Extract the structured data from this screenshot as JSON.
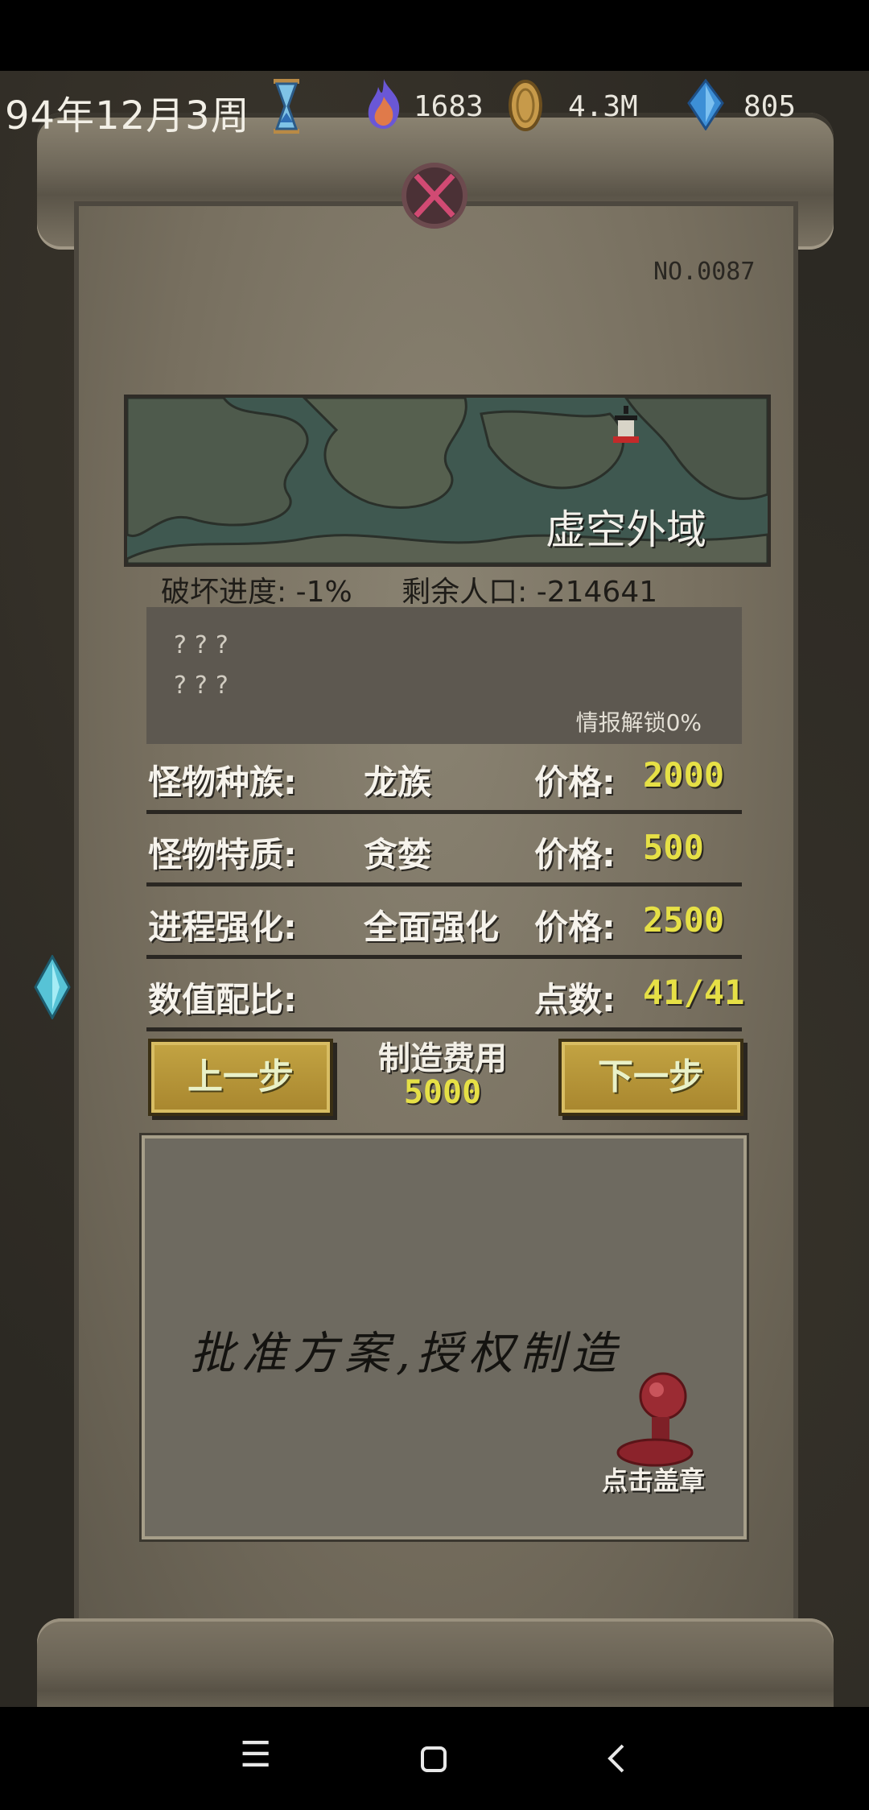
{
  "hud": {
    "date": "94年12月3周",
    "flame": "1683",
    "coin": "4.3M",
    "crystal": "805"
  },
  "scroll": {
    "serial": "NO.0087"
  },
  "region": {
    "name": "虚空外域",
    "destruction": "破坏进度: -1%",
    "population": "剩余人口: -214641"
  },
  "intel": {
    "line1": "???",
    "line2": "???",
    "unlock": "情报解锁0%"
  },
  "rows": [
    {
      "label": "怪物种族:",
      "value": "龙族",
      "price_label": "价格:",
      "price": "2000"
    },
    {
      "label": "怪物特质:",
      "value": "贪婪",
      "price_label": "价格:",
      "price": "500"
    },
    {
      "label": "进程强化:",
      "value": "全面强化",
      "price_label": "价格:",
      "price": "2500"
    },
    {
      "label": "数值配比:",
      "value": "",
      "price_label": "点数:",
      "price": "41/41"
    }
  ],
  "buttons": {
    "prev": "上一步",
    "next": "下一步"
  },
  "cost": {
    "label": "制造费用",
    "value": "5000"
  },
  "approve": {
    "text": "批准方案,授权制造",
    "stamp_label": "点击盖章"
  },
  "colors": {
    "price": "#e6e046",
    "button": "#b8983a",
    "panel": "#5d5850"
  }
}
